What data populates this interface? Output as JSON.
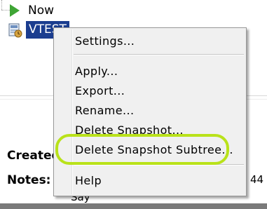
{
  "tree": {
    "now_label": "Now",
    "vm_label": "VTEST"
  },
  "details": {
    "created_label": "Created",
    "notes_label": "Notes:",
    "notes_value": "Say",
    "right_value": "44"
  },
  "context_menu": {
    "items": [
      {
        "label": "Settings..."
      },
      {
        "label": "Apply..."
      },
      {
        "label": "Export..."
      },
      {
        "label": "Rename..."
      },
      {
        "label": "Delete Snapshot..."
      },
      {
        "label": "Delete Snapshot Subtree..."
      },
      {
        "label": "Help"
      }
    ]
  },
  "colors": {
    "selection": "#1b3d8f",
    "highlight_ring": "#b9e21a",
    "play_icon": "#3fa535"
  }
}
